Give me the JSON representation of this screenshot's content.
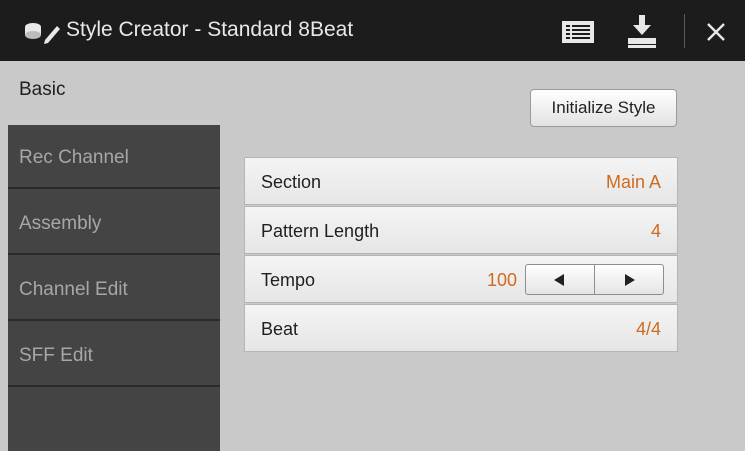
{
  "titlebar": {
    "title": "Style Creator - Standard 8Beat",
    "icons": [
      "style-creator-icon",
      "list-icon",
      "save-icon",
      "close-icon"
    ],
    "close_glyph": "×"
  },
  "sidebar": {
    "tabs": [
      {
        "label": "Basic",
        "active": true
      },
      {
        "label": "Rec Channel",
        "active": false
      },
      {
        "label": "Assembly",
        "active": false
      },
      {
        "label": "Channel Edit",
        "active": false
      },
      {
        "label": "SFF Edit",
        "active": false
      }
    ]
  },
  "main": {
    "initialize_label": "Initialize Style",
    "rows": [
      {
        "label": "Section",
        "value": "Main A"
      },
      {
        "label": "Pattern Length",
        "value": "4"
      },
      {
        "label": "Tempo",
        "value": "100"
      },
      {
        "label": "Beat",
        "value": "4/4"
      }
    ]
  },
  "colors": {
    "titlebar": "#1c1c1c",
    "sidebar": "#444444",
    "background": "#c9c9c9",
    "value_accent": "#d06a1c"
  }
}
